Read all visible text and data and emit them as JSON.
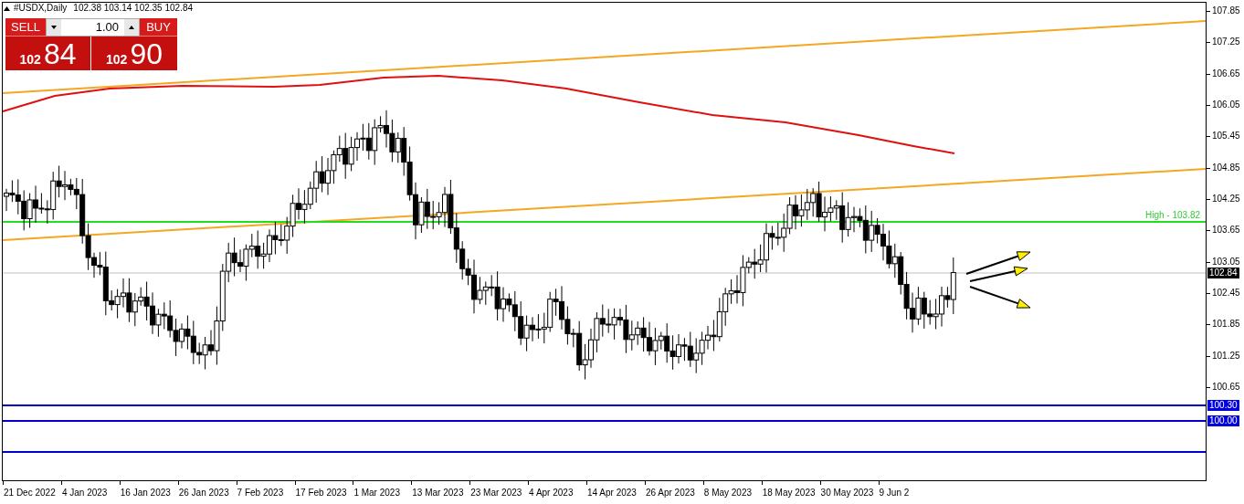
{
  "chart": {
    "title": "#USDX,Daily",
    "ohlc": "102.38 103.14 102.35 102.84"
  },
  "trade_panel": {
    "sell_label": "SELL",
    "buy_label": "BUY",
    "volume": "1.00",
    "sell_price": {
      "big_figure": "102",
      "pips": "84"
    },
    "buy_price": {
      "big_figure": "102",
      "pips": "90"
    }
  },
  "price_axis": [
    "107.85",
    "107.25",
    "106.65",
    "106.05",
    "105.45",
    "104.85",
    "104.25",
    "103.65",
    "103.05",
    "102.45",
    "101.85",
    "101.25",
    "100.65"
  ],
  "date_axis": [
    "21 Dec 2022",
    "4 Jan 2023",
    "16 Jan 2023",
    "26 Jan 2023",
    "7 Feb 2023",
    "17 Feb 2023",
    "1 Mar 2023",
    "13 Mar 2023",
    "23 Mar 2023",
    "4 Apr 2023",
    "14 Apr 2023",
    "26 Apr 2023",
    "8 May 2023",
    "18 May 2023",
    "30 May 2023",
    "9 Jun 2"
  ],
  "horizontal_lines": [
    {
      "kind": "high",
      "label": "High - 103.82"
    },
    {
      "kind": "current",
      "tag": "102.84"
    },
    {
      "kind": "support",
      "tag": "100.30"
    },
    {
      "kind": "support",
      "tag": "100.00"
    },
    {
      "kind": "support"
    }
  ]
}
